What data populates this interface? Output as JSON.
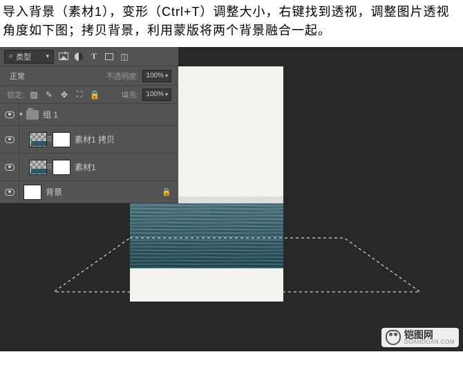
{
  "instruction": "导入背景（素材1），变形（Ctrl+T）调整大小，右键找到透视，调整图片透视角度如下图；拷贝背景，利用蒙版将两个背景融合一起。",
  "panel": {
    "search_icon": "⌕",
    "filter_label": "类型",
    "blend_mode": "正常",
    "opacity_label": "不透明度:",
    "opacity_value": "100%",
    "lock_label": "锁定:",
    "fill_label": "填充:",
    "fill_value": "100%"
  },
  "layers": {
    "group": "组 1",
    "layer1": "素材1 拷贝",
    "layer2": "素材1",
    "bg": "背景"
  },
  "watermark": {
    "title": "铠图网",
    "url": "DOANDOAN.COM"
  }
}
